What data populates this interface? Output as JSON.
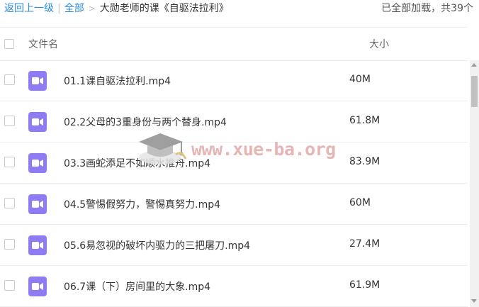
{
  "breadcrumb": {
    "back": "返回上一级",
    "separator": "|",
    "all": "全部",
    "arrow": ">",
    "current": "大勋老师的课《自驱法拉利》"
  },
  "status": "已全部加载，共39个",
  "columns": {
    "name": "文件名",
    "size": "大小"
  },
  "files": [
    {
      "name": "01.1课自驱法拉利.mp4",
      "size": "40M",
      "icon": "video-file-icon"
    },
    {
      "name": "02.2父母的3重身份与两个替身.mp4",
      "size": "61.8M",
      "icon": "video-file-icon"
    },
    {
      "name": "03.3画蛇添足不如顺水推舟.mp4",
      "size": "83.9M",
      "icon": "video-file-icon"
    },
    {
      "name": "04.5警惕假努力，警惕真努力.mp4",
      "size": "60M",
      "icon": "video-file-icon"
    },
    {
      "name": "05.6易忽视的破坏内驱力的三把屠刀.mp4",
      "size": "27.4M",
      "icon": "video-file-icon"
    },
    {
      "name": "06.7课（下）房间里的大象.mp4",
      "size": "61.9M",
      "icon": "video-file-icon"
    }
  ],
  "watermark": {
    "text": "www.xue-ba.org"
  },
  "colors": {
    "link": "#2a8ce0",
    "video_icon": "#8f7cf3",
    "watermark": "#e2a9a9"
  }
}
